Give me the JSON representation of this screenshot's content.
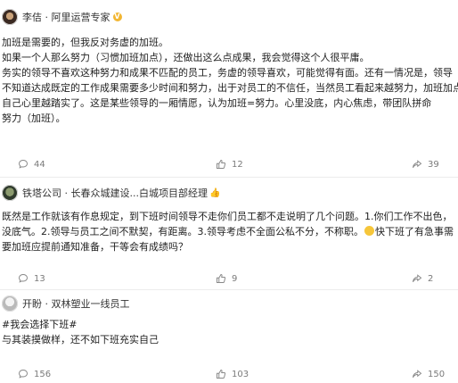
{
  "posts": [
    {
      "author": "李佶 · 阿里运营专家",
      "verified": "V",
      "lines": [
        "加班是需要的，但我反对务虚的加班。",
        "如果一个人那么努力（习惯加班加点），还做出这么点成果，我会觉得这个人很平庸。",
        "务实的领导不喜欢这种努力和成果不匹配的员工，务虚的领导喜欢，可能觉得有面。还有一情况是，领导",
        "不知道达成既定的工作成果需要多少时间和努力，出于对员工的不信任，当然员工看起来越努力，加班加点，",
        "自己心里越踏实了。这是某些领导的一厢情愿，认为加班=努力。心里没底，内心焦虑，带团队拼命",
        "努力（加班）。"
      ],
      "comments": "44",
      "likes": "12",
      "shares": "39"
    },
    {
      "author": "铁塔公司 · 长春众城建设...白城项目部经理",
      "hand": "👍",
      "lines": [
        "既然是工作就该有作息规定，到下班时间领导不走你们员工都不走说明了几个问题。1.你们工作不出色，",
        "没底气。2.领导与员工之间不默契，有距离。3.领导考虑不全面公私不分，不称职。",
        "要加班应提前通知准备，干等会有成绩吗？"
      ],
      "line2_tail": "快下班了有急事需",
      "comments": "13",
      "likes": "9",
      "shares": "2"
    },
    {
      "author": "开盼 · 双林塑业一线员工",
      "lines": [
        "#我会选择下班#",
        "与其装摸做样，还不如下班充实自己"
      ],
      "comments": "156",
      "likes": "103",
      "shares": "150"
    }
  ]
}
